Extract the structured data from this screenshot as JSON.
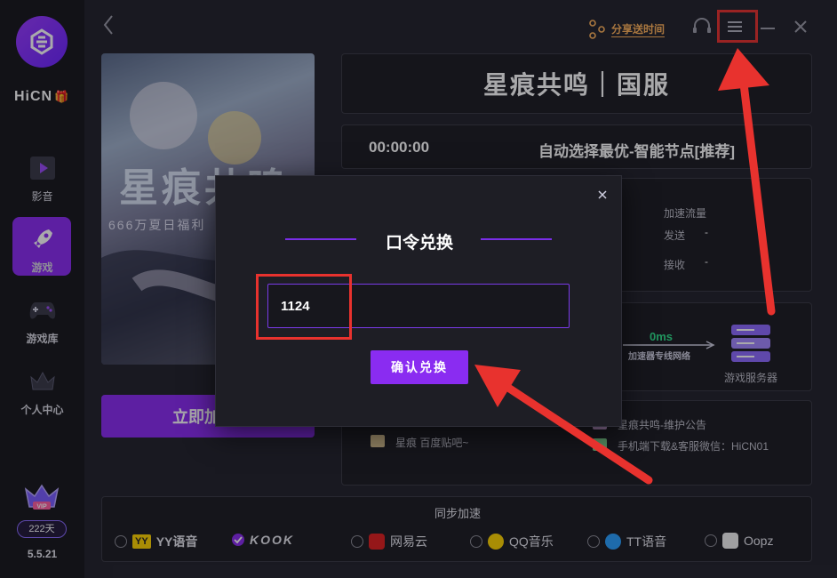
{
  "sidebar": {
    "brand": "HiCN",
    "items": [
      {
        "label": "影音",
        "icon": "video-icon"
      },
      {
        "label": "游戏",
        "icon": "rocket-icon",
        "active": true
      },
      {
        "label": "游戏库",
        "icon": "gamepad-icon"
      },
      {
        "label": "个人中心",
        "icon": "crown-icon"
      }
    ],
    "vip_badge": "VIP",
    "vip_days": "222天",
    "version": "5.5.21"
  },
  "topbar": {
    "share_label": "分享送时间"
  },
  "banner": {
    "title": "星痕共鸣",
    "subtitle": "666万夏日福利",
    "start_button": "立即加"
  },
  "game": {
    "title": "星痕共鸣｜国服",
    "timer": "00:00:00",
    "node": "自动选择最优-智能节点[推荐]",
    "stats": {
      "traffic_label": "加速流量",
      "send_label": "发送",
      "send_value": "-",
      "recv_label": "接收",
      "recv_value": "-"
    },
    "network": {
      "latency": "0ms",
      "route_label": "加速器专线网络",
      "server_label": "游戏服务器"
    },
    "info": {
      "left": [
        "星痕 百度贴吧~"
      ],
      "right": [
        "星痕共鸣-维护公告",
        "手机端下载&客服微信：HiCN01"
      ]
    }
  },
  "sync": {
    "label": "同步加速",
    "options": [
      {
        "name": "YY语音",
        "checked": false
      },
      {
        "name": "KOOK",
        "checked": true
      },
      {
        "name": "网易云",
        "checked": false
      },
      {
        "name": "QQ音乐",
        "checked": false
      },
      {
        "name": "TT语音",
        "checked": false
      },
      {
        "name": "Oopz",
        "checked": false
      }
    ]
  },
  "modal": {
    "title": "口令兑换",
    "code_value": "1124",
    "confirm_label": "确认兑换"
  },
  "colors": {
    "accent": "#8a2cf1",
    "highlight": "#e8322e",
    "latency": "#2fe08a",
    "share": "#ffb25a"
  }
}
